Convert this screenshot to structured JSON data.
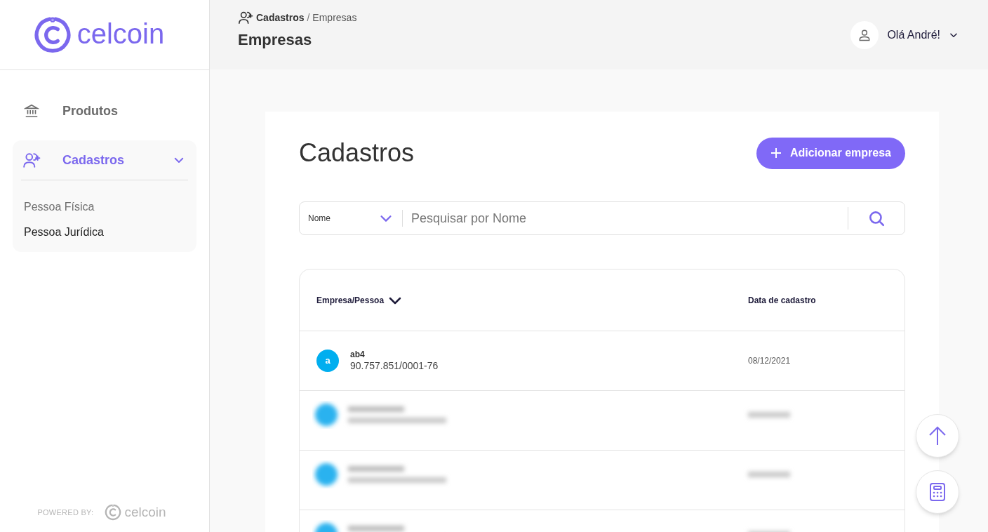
{
  "logo": {
    "text": "celcoin"
  },
  "sidebar": {
    "items": [
      {
        "kind": "link",
        "label": "Produtos",
        "selected": false
      },
      {
        "kind": "group",
        "label": "Cadastros",
        "selected": true,
        "expanded": true,
        "children": [
          {
            "label": "Pessoa Física",
            "selected": false
          },
          {
            "label": "Pessoa Jurídica",
            "selected": true
          }
        ]
      }
    ],
    "footer": {
      "label": "POWERED BY:",
      "logo": "celcoin"
    }
  },
  "header": {
    "breadcrumb": [
      {
        "label": "Cadastros"
      },
      {
        "label": "Empresas"
      }
    ],
    "separator": "/",
    "title": "Empresas",
    "user": "Olá André!"
  },
  "page": {
    "title": "Cadastros",
    "add_button": "Adicionar empresa",
    "search": {
      "filter": "Nome",
      "placeholder": "Pesquisar por Nome"
    },
    "table": {
      "columns": [
        {
          "label": "Empresa/Pessoa",
          "sortable": true
        },
        {
          "label": "Data de cadastro",
          "sortable": false
        }
      ],
      "rows": [
        {
          "kind": "visible",
          "avatar": "a",
          "color": "#00aeef",
          "name": "ab4",
          "document": "90.757.851/0001-76",
          "date": "08/12/2021"
        },
        {
          "kind": "blurred"
        },
        {
          "kind": "blurred"
        },
        {
          "kind": "blurred"
        }
      ]
    }
  }
}
